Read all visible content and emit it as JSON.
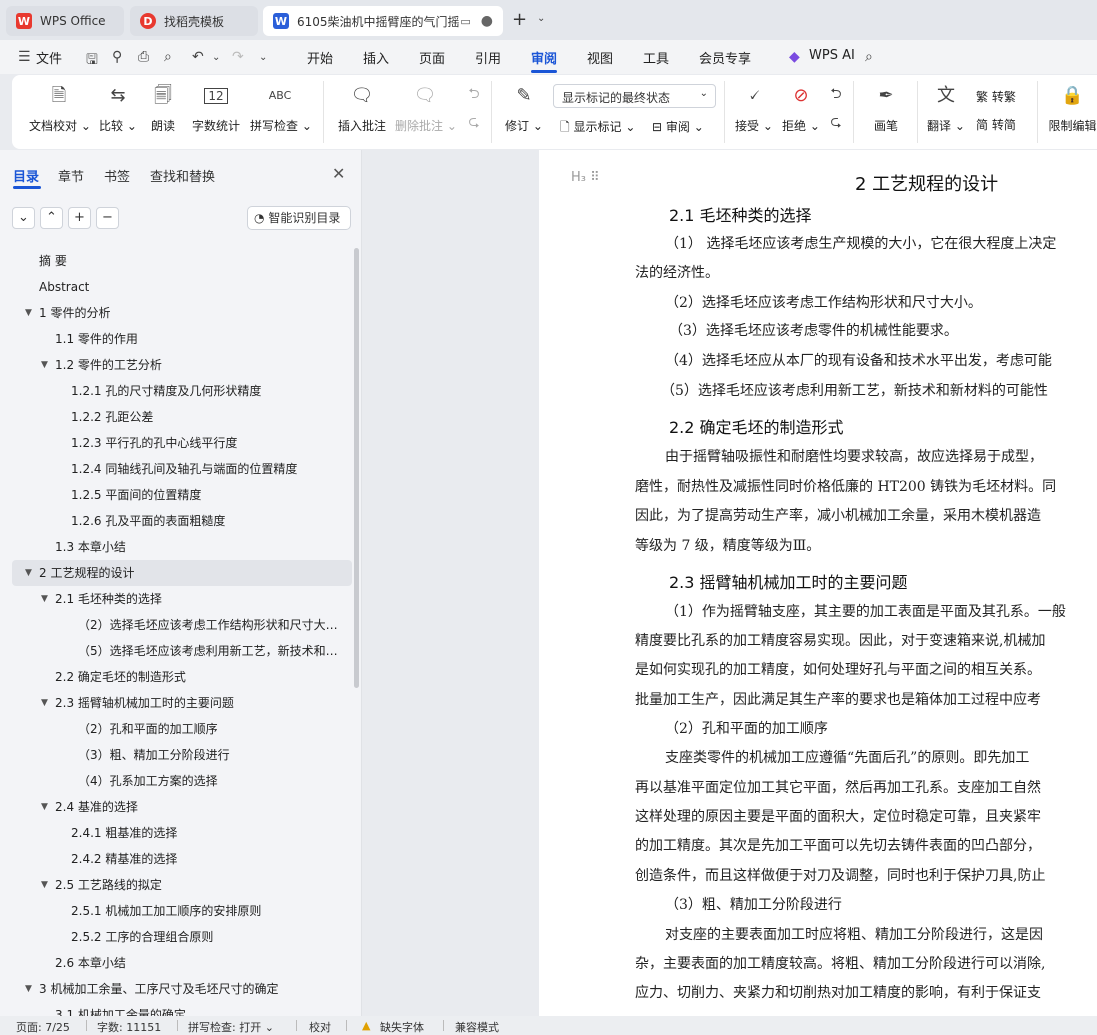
{
  "tabs": [
    {
      "label": "WPS Office",
      "logo": "W"
    },
    {
      "label": "找稻壳模板",
      "logo": "D"
    },
    {
      "label": "6105柴油机中摇臂座的气门摇",
      "logo": "W"
    }
  ],
  "menu": {
    "file": "文件",
    "items": [
      "开始",
      "插入",
      "页面",
      "引用",
      "审阅",
      "视图",
      "工具",
      "会员专享"
    ],
    "active": "审阅",
    "ai": "WPS AI"
  },
  "ribbon": {
    "doc_check": "文档校对",
    "compare": "比较",
    "read_aloud": "朗读",
    "word_count": "字数统计",
    "spell_check": "拼写检查",
    "insert_comment": "插入批注",
    "delete_comment": "删除批注",
    "revise": "修订",
    "markup_mode": "显示标记的最终状态",
    "show_markup": "显示标记",
    "review": "审阅",
    "accept": "接受",
    "reject": "拒绝",
    "pen": "画笔",
    "translate": "翻译",
    "to_traditional": "转繁",
    "to_simplified": "转简",
    "restrict_edit": "限制编辑",
    "word_count_icon_text": "12",
    "spell_icon_text": "ABC"
  },
  "panel": {
    "tabs": [
      "目录",
      "章节",
      "书签",
      "查找和替换"
    ],
    "smart_toc": "智能识别目录",
    "toc": [
      {
        "text": "摘  要",
        "level": 0,
        "arrow": false
      },
      {
        "text": "Abstract",
        "level": 0,
        "arrow": false
      },
      {
        "text": "1  零件的分析",
        "level": 0,
        "arrow": true
      },
      {
        "text": "1.1   零件的作用",
        "level": 1,
        "arrow": false
      },
      {
        "text": "1.2   零件的工艺分析",
        "level": 1,
        "arrow": true
      },
      {
        "text": "1.2.1   孔的尺寸精度及几何形状精度",
        "level": 2,
        "arrow": false
      },
      {
        "text": "1.2.2   孔距公差",
        "level": 2,
        "arrow": false
      },
      {
        "text": "1.2.3   平行孔的孔中心线平行度",
        "level": 2,
        "arrow": false
      },
      {
        "text": "1.2.4   同轴线孔间及轴孔与端面的位置精度",
        "level": 2,
        "arrow": false
      },
      {
        "text": "1.2.5   平面间的位置精度",
        "level": 2,
        "arrow": false
      },
      {
        "text": "1.2.6   孔及平面的表面粗糙度",
        "level": 2,
        "arrow": false
      },
      {
        "text": "1.3   本章小结",
        "level": 1,
        "arrow": false
      },
      {
        "text": "2   工艺规程的设计",
        "level": 0,
        "arrow": true,
        "selected": true
      },
      {
        "text": "2.1   毛坯种类的选择",
        "level": 1,
        "arrow": true
      },
      {
        "text": "（2）选择毛坯应该考虑工作结构形状和尺寸大小...",
        "level": 3,
        "arrow": false
      },
      {
        "text": "（5）选择毛坯应该考虑利用新工艺，新技术和新...",
        "level": 3,
        "arrow": false
      },
      {
        "text": "2.2   确定毛坯的制造形式",
        "level": 1,
        "arrow": false
      },
      {
        "text": "2.3   摇臂轴机械加工时的主要问题",
        "level": 1,
        "arrow": true
      },
      {
        "text": "（2）孔和平面的加工顺序",
        "level": 3,
        "arrow": false
      },
      {
        "text": "（3）粗、精加工分阶段进行",
        "level": 3,
        "arrow": false
      },
      {
        "text": "（4）孔系加工方案的选择",
        "level": 3,
        "arrow": false
      },
      {
        "text": "2.4   基准的选择",
        "level": 1,
        "arrow": true
      },
      {
        "text": "2.4.1   粗基准的选择",
        "level": 2,
        "arrow": false
      },
      {
        "text": "2.4.2   精基准的选择",
        "level": 2,
        "arrow": false
      },
      {
        "text": "2.5   工艺路线的拟定",
        "level": 1,
        "arrow": true
      },
      {
        "text": "2.5.1   机械加工加工顺序的安排原则",
        "level": 2,
        "arrow": false
      },
      {
        "text": "2.5.2   工序的合理组合原则",
        "level": 2,
        "arrow": false
      },
      {
        "text": "2.6   本章小结",
        "level": 1,
        "arrow": false
      },
      {
        "text": "3   机械加工余量、工序尺寸及毛坯尺寸的确定",
        "level": 0,
        "arrow": true
      },
      {
        "text": "3.1   机械加工余量的确定",
        "level": 1,
        "arrow": false
      }
    ]
  },
  "doc": {
    "heading_marker": "H₃",
    "h1": "2   工艺规程的设计",
    "h2_1": "2.1   毛坯种类的选择",
    "p1": "（1） 选择毛坯应该考虑生产规模的大小，它在很大程度上决定",
    "p1b": "法的经济性。",
    "p2": "（2）选择毛坯应该考虑工作结构形状和尺寸大小。",
    "p3": "（3）选择毛坯应该考虑零件的机械性能要求。",
    "p4": "（4）选择毛坯应从本厂的现有设备和技术水平出发，考虑可能",
    "p5": "（5）选择毛坯应该考虑利用新工艺，新技术和新材料的可能性",
    "h2_2": "2.2   确定毛坯的制造形式",
    "p6": "由于摇臂轴吸振性和耐磨性均要求较高，故应选择易于成型，",
    "p6b": "磨性，耐热性及减振性同时价格低廉的 HT200 铸铁为毛坯材料。同",
    "p6c": "因此，为了提高劳动生产率，减小机械加工余量，采用木模机器造",
    "p6d": "等级为 7 级，精度等级为Ⅲ。",
    "h2_3": "2.3   摇臂轴机械加工时的主要问题",
    "p7": "（1）作为摇臂轴支座，其主要的加工表面是平面及其孔系。一般",
    "p7b": "精度要比孔系的加工精度容易实现。因此，对于变速箱来说,机械加",
    "p7c": "是如何实现孔的加工精度，如何处理好孔与平面之间的相互关系。",
    "p7d": "批量加工生产，因此满足其生产率的要求也是箱体加工过程中应考",
    "p8": "（2）孔和平面的加工顺序",
    "p9": "支座类零件的机械加工应遵循“先面后孔”的原则。即先加工",
    "p9b": "再以基准平面定位加工其它平面，然后再加工孔系。支座加工自然",
    "p9c": "这样处理的原因主要是平面的面积大，定位时稳定可靠，且夹紧牢",
    "p9d": "的加工精度。其次是先加工平面可以先切去铸件表面的凹凸部分，",
    "p9e": "创造条件，而且这样做便于对刀及调整，同时也利于保护刀具,防止",
    "p10": "（3）粗、精加工分阶段进行",
    "p11": "对支座的主要表面加工时应将粗、精加工分阶段进行，这是因",
    "p11b": "杂，主要表面的加工精度较高。将粗、精加工分阶段进行可以消除,",
    "p11c": "应力、切削力、夹紧力和切削热对加工精度的影响，有利于保证支"
  },
  "status": {
    "page": "页面: 7/25",
    "words": "字数: 11151",
    "spell": "拼写检查: 打开",
    "proof": "校对",
    "missing_font": "缺失字体",
    "compat": "兼容模式"
  },
  "colors": {
    "accent": "#1a55d6",
    "wps_red": "#e8392f",
    "doc_blue": "#2b5fd9"
  }
}
